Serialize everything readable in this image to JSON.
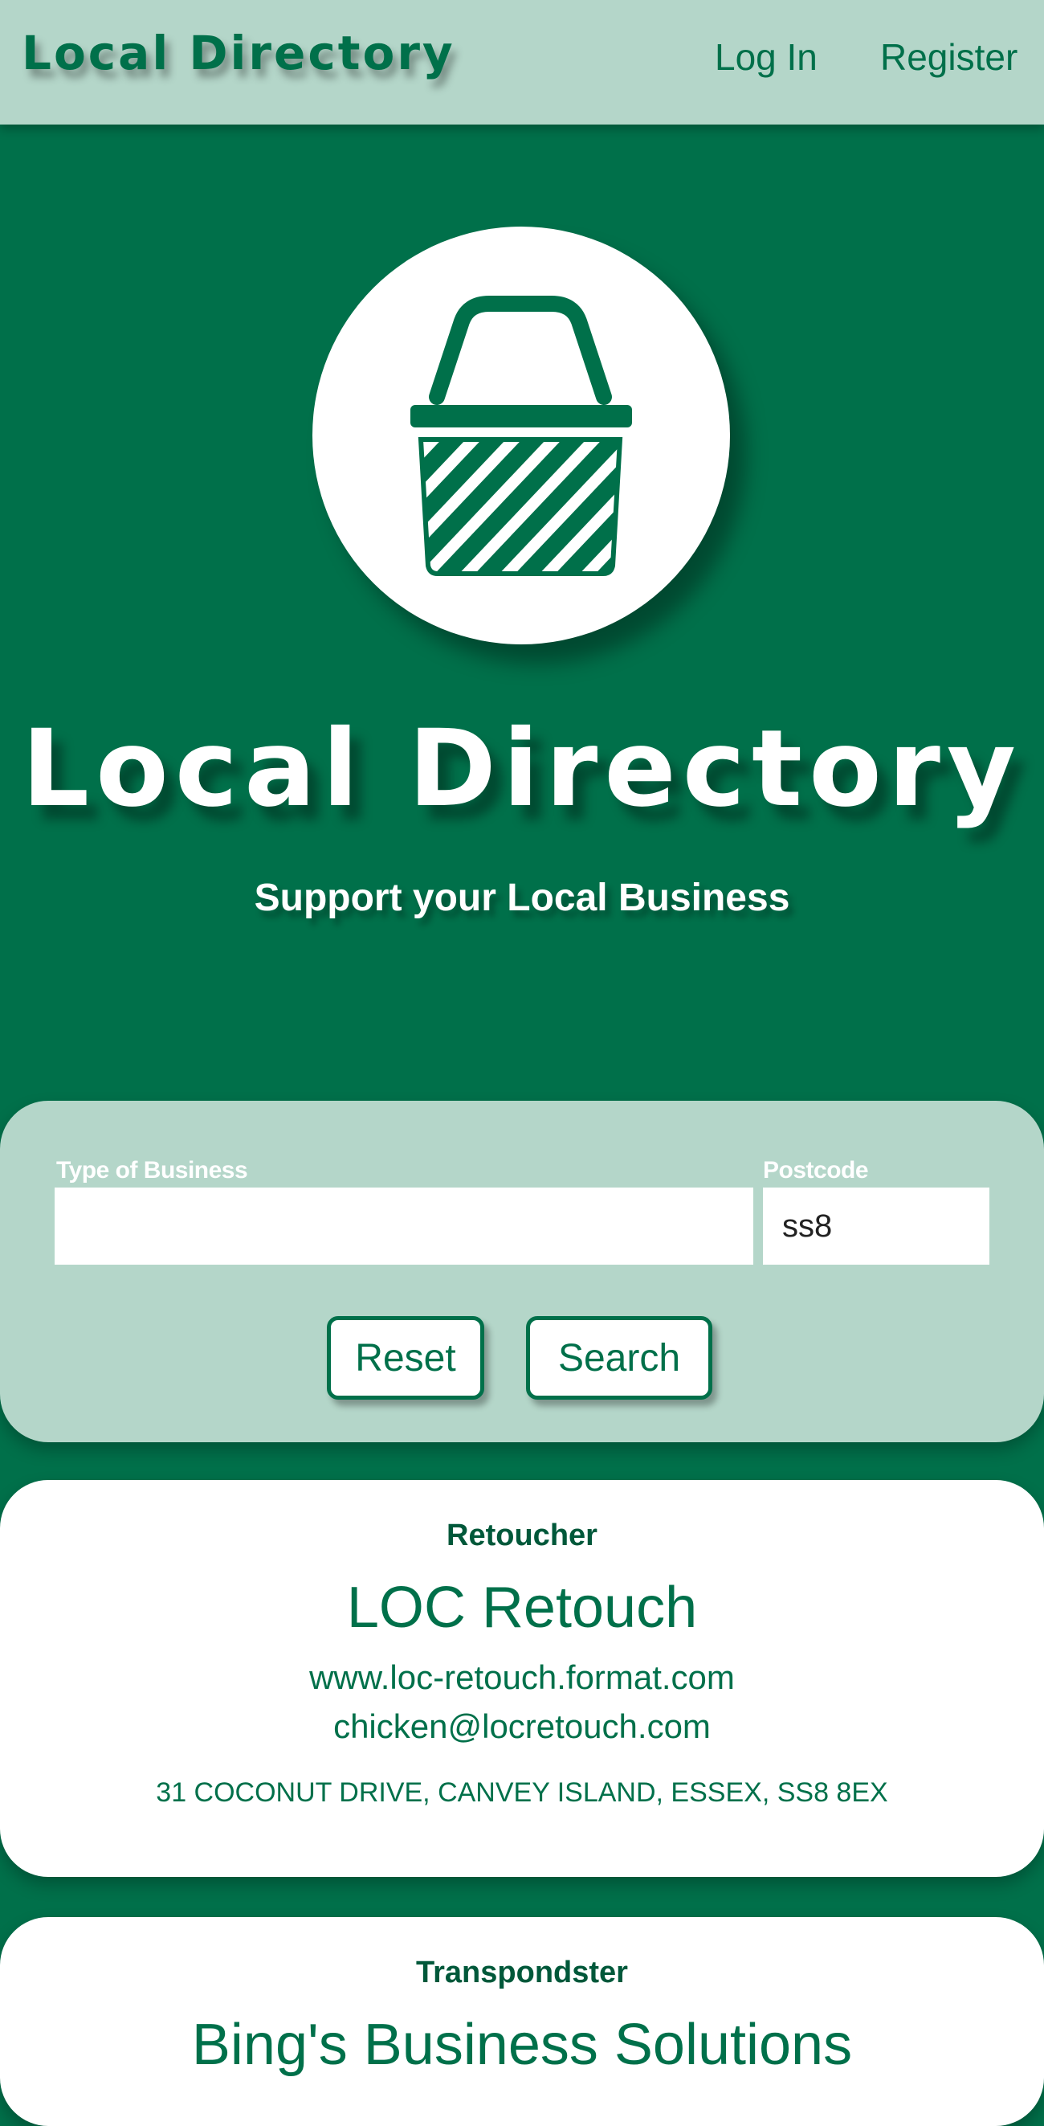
{
  "header": {
    "brand": "Local Directory",
    "nav": {
      "login": "Log In",
      "register": "Register"
    }
  },
  "hero": {
    "logo_icon": "shopping-basket-icon",
    "title": "Local Directory",
    "subtitle": "Support your Local Business"
  },
  "search": {
    "type_label": "Type of Business",
    "type_value": "",
    "postcode_label": "Postcode",
    "postcode_value": "ss8",
    "reset_label": "Reset",
    "search_label": "Search"
  },
  "results": [
    {
      "category": "Retoucher",
      "name": "LOC Retouch",
      "website": "www.loc-retouch.format.com",
      "email": "chicken@locretouch.com",
      "address": "31 COCONUT DRIVE, CANVEY ISLAND, ESSEX, SS8 8EX"
    },
    {
      "category": "Transpondster",
      "name": "Bing's Business Solutions"
    }
  ],
  "colors": {
    "primary": "#00704a",
    "header_bg": "#b4d6c9",
    "card_bg": "#ffffff"
  }
}
